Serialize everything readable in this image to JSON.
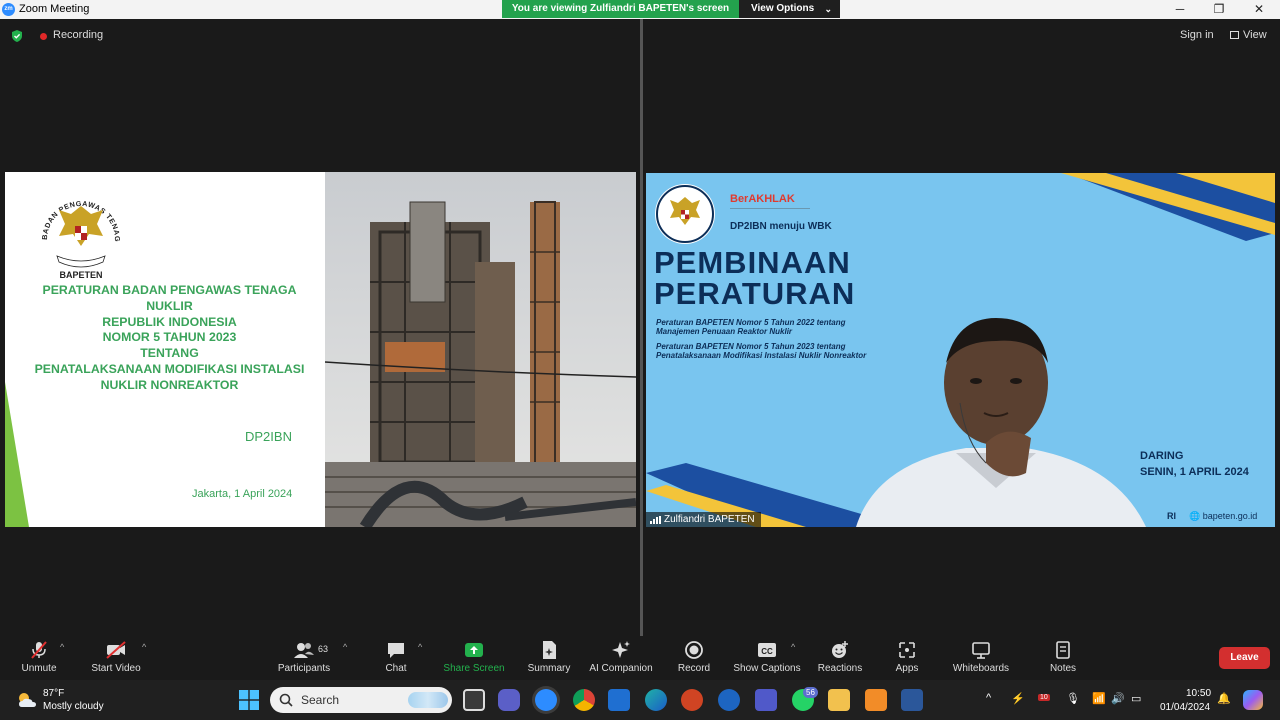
{
  "titlebar": {
    "app_title": "Zoom Meeting",
    "share_banner": "You are viewing Zulfiandri BAPETEN's screen",
    "view_options": "View Options"
  },
  "header": {
    "recording": "Recording",
    "sign_in": "Sign in",
    "view": "View"
  },
  "shared_slide": {
    "title_lines": [
      "PERATURAN BADAN PENGAWAS TENAGA",
      "NUKLIR",
      "REPUBLIK INDONESIA",
      "NOMOR 5 TAHUN 2023",
      "TENTANG",
      "PENATALAKSANAAN MODIFIKASI INSTALASI",
      "NUKLIR NONREAKTOR"
    ],
    "division": "DP2IBN",
    "date": "Jakarta,  1 April 2024",
    "emblem_text": "BADAN PENGAWAS TENAGA NUKLIR",
    "emblem_label": "BAPETEN",
    "colors": {
      "accent_green": "#3aa35a",
      "bar_green": "#7cc242"
    }
  },
  "participant_video": {
    "name": "Zulfiandri BAPETEN",
    "berakhlak": "BerAKHLAK",
    "dp2ibn": "DP2IBN menuju WBK",
    "heading_line1": "PEMBINAAN",
    "heading_line2": "PERATURAN",
    "reg1_line1": "Peraturan  BAPETEN  Nomor  5  Tahun  2022  tentang",
    "reg1_line2": "Manajemen Penuaan Reaktor Nuklir",
    "reg2_line1": "Peraturan  BAPETEN  Nomor  5  Tahun  2023  tentang",
    "reg2_line2": "Penatalaksanaan Modifikasi Instalasi Nuklir Nonreaktor",
    "daring": "DARING",
    "date": "SENIN, 1 APRIL 2024",
    "website": "bapeten.go.id",
    "ri": "RI",
    "bg_color": "#79c5ef",
    "heading_color": "#0c2e58"
  },
  "toolbar": {
    "unmute": "Unmute",
    "start_video": "Start Video",
    "participants": "Participants",
    "participants_count": "63",
    "chat": "Chat",
    "share_screen": "Share Screen",
    "summary": "Summary",
    "ai_companion": "AI Companion",
    "record": "Record",
    "show_captions": "Show Captions",
    "reactions": "Reactions",
    "apps": "Apps",
    "whiteboards": "Whiteboards",
    "notes": "Notes",
    "leave": "Leave"
  },
  "taskbar": {
    "temperature": "87°F",
    "weather": "Mostly cloudy",
    "search_placeholder": "Search",
    "whatsapp_badge": "56",
    "calendar_badge": "10",
    "time": "10:50",
    "date": "01/04/2024"
  }
}
